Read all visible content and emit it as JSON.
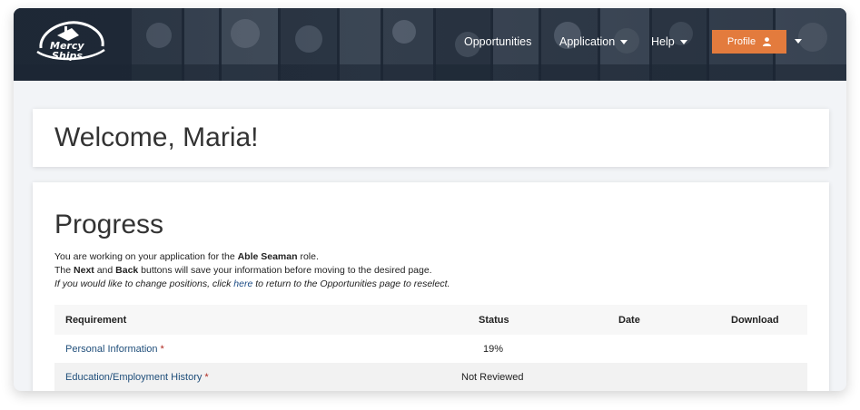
{
  "brand": {
    "logo_text_line1": "Mercy",
    "logo_text_line2": "Ships"
  },
  "nav": {
    "opportunities": "Opportunities",
    "application": "Application",
    "help": "Help",
    "profile": "Profile"
  },
  "colors": {
    "accent": "#e37b3d",
    "link": "#1f4e7a",
    "required": "#b0281f",
    "navbar": "#222d3a"
  },
  "welcome": {
    "title": "Welcome, Maria!"
  },
  "progress": {
    "title": "Progress",
    "line1_pre": "You are working on your application for the ",
    "line1_role": "Able Seaman",
    "line1_post": " role.",
    "line2_pre": "The ",
    "line2_next": "Next",
    "line2_mid": " and ",
    "line2_back": "Back",
    "line2_post": " buttons will save your information before moving to the desired page.",
    "line3_pre": "If you would like to change positions, click ",
    "line3_link": "here",
    "line3_post": " to return to the Opportunities page to reselect."
  },
  "table": {
    "headers": {
      "requirement": "Requirement",
      "status": "Status",
      "date": "Date",
      "download": "Download"
    },
    "rows": [
      {
        "requirement": "Personal Information",
        "required_mark": "*",
        "status": "19%",
        "date": "",
        "download": ""
      },
      {
        "requirement": "Education/Employment History",
        "required_mark": "*",
        "status": "Not Reviewed",
        "date": "",
        "download": ""
      }
    ]
  },
  "icons": {
    "profile": "user-icon",
    "dropdown": "caret-down-icon",
    "logo": "ship-logo-icon"
  }
}
